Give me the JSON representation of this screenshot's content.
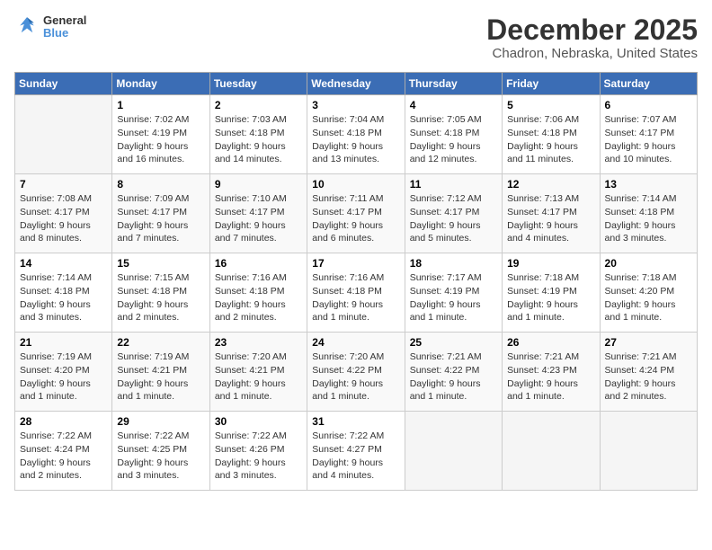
{
  "header": {
    "logo": {
      "line1": "General",
      "line2": "Blue"
    },
    "title": "December 2025",
    "location": "Chadron, Nebraska, United States"
  },
  "weekdays": [
    "Sunday",
    "Monday",
    "Tuesday",
    "Wednesday",
    "Thursday",
    "Friday",
    "Saturday"
  ],
  "weeks": [
    [
      {
        "day": null
      },
      {
        "day": "1",
        "sunrise": "7:02 AM",
        "sunset": "4:19 PM",
        "daylight": "9 hours and 16 minutes."
      },
      {
        "day": "2",
        "sunrise": "7:03 AM",
        "sunset": "4:18 PM",
        "daylight": "9 hours and 14 minutes."
      },
      {
        "day": "3",
        "sunrise": "7:04 AM",
        "sunset": "4:18 PM",
        "daylight": "9 hours and 13 minutes."
      },
      {
        "day": "4",
        "sunrise": "7:05 AM",
        "sunset": "4:18 PM",
        "daylight": "9 hours and 12 minutes."
      },
      {
        "day": "5",
        "sunrise": "7:06 AM",
        "sunset": "4:18 PM",
        "daylight": "9 hours and 11 minutes."
      },
      {
        "day": "6",
        "sunrise": "7:07 AM",
        "sunset": "4:17 PM",
        "daylight": "9 hours and 10 minutes."
      }
    ],
    [
      {
        "day": "7",
        "sunrise": "7:08 AM",
        "sunset": "4:17 PM",
        "daylight": "9 hours and 8 minutes."
      },
      {
        "day": "8",
        "sunrise": "7:09 AM",
        "sunset": "4:17 PM",
        "daylight": "9 hours and 7 minutes."
      },
      {
        "day": "9",
        "sunrise": "7:10 AM",
        "sunset": "4:17 PM",
        "daylight": "9 hours and 7 minutes."
      },
      {
        "day": "10",
        "sunrise": "7:11 AM",
        "sunset": "4:17 PM",
        "daylight": "9 hours and 6 minutes."
      },
      {
        "day": "11",
        "sunrise": "7:12 AM",
        "sunset": "4:17 PM",
        "daylight": "9 hours and 5 minutes."
      },
      {
        "day": "12",
        "sunrise": "7:13 AM",
        "sunset": "4:17 PM",
        "daylight": "9 hours and 4 minutes."
      },
      {
        "day": "13",
        "sunrise": "7:14 AM",
        "sunset": "4:18 PM",
        "daylight": "9 hours and 3 minutes."
      }
    ],
    [
      {
        "day": "14",
        "sunrise": "7:14 AM",
        "sunset": "4:18 PM",
        "daylight": "9 hours and 3 minutes."
      },
      {
        "day": "15",
        "sunrise": "7:15 AM",
        "sunset": "4:18 PM",
        "daylight": "9 hours and 2 minutes."
      },
      {
        "day": "16",
        "sunrise": "7:16 AM",
        "sunset": "4:18 PM",
        "daylight": "9 hours and 2 minutes."
      },
      {
        "day": "17",
        "sunrise": "7:16 AM",
        "sunset": "4:18 PM",
        "daylight": "9 hours and 1 minute."
      },
      {
        "day": "18",
        "sunrise": "7:17 AM",
        "sunset": "4:19 PM",
        "daylight": "9 hours and 1 minute."
      },
      {
        "day": "19",
        "sunrise": "7:18 AM",
        "sunset": "4:19 PM",
        "daylight": "9 hours and 1 minute."
      },
      {
        "day": "20",
        "sunrise": "7:18 AM",
        "sunset": "4:20 PM",
        "daylight": "9 hours and 1 minute."
      }
    ],
    [
      {
        "day": "21",
        "sunrise": "7:19 AM",
        "sunset": "4:20 PM",
        "daylight": "9 hours and 1 minute."
      },
      {
        "day": "22",
        "sunrise": "7:19 AM",
        "sunset": "4:21 PM",
        "daylight": "9 hours and 1 minute."
      },
      {
        "day": "23",
        "sunrise": "7:20 AM",
        "sunset": "4:21 PM",
        "daylight": "9 hours and 1 minute."
      },
      {
        "day": "24",
        "sunrise": "7:20 AM",
        "sunset": "4:22 PM",
        "daylight": "9 hours and 1 minute."
      },
      {
        "day": "25",
        "sunrise": "7:21 AM",
        "sunset": "4:22 PM",
        "daylight": "9 hours and 1 minute."
      },
      {
        "day": "26",
        "sunrise": "7:21 AM",
        "sunset": "4:23 PM",
        "daylight": "9 hours and 1 minute."
      },
      {
        "day": "27",
        "sunrise": "7:21 AM",
        "sunset": "4:24 PM",
        "daylight": "9 hours and 2 minutes."
      }
    ],
    [
      {
        "day": "28",
        "sunrise": "7:22 AM",
        "sunset": "4:24 PM",
        "daylight": "9 hours and 2 minutes."
      },
      {
        "day": "29",
        "sunrise": "7:22 AM",
        "sunset": "4:25 PM",
        "daylight": "9 hours and 3 minutes."
      },
      {
        "day": "30",
        "sunrise": "7:22 AM",
        "sunset": "4:26 PM",
        "daylight": "9 hours and 3 minutes."
      },
      {
        "day": "31",
        "sunrise": "7:22 AM",
        "sunset": "4:27 PM",
        "daylight": "9 hours and 4 minutes."
      },
      {
        "day": null
      },
      {
        "day": null
      },
      {
        "day": null
      }
    ]
  ],
  "labels": {
    "sunrise_prefix": "Sunrise: ",
    "sunset_prefix": "Sunset: ",
    "daylight_prefix": "Daylight: "
  }
}
